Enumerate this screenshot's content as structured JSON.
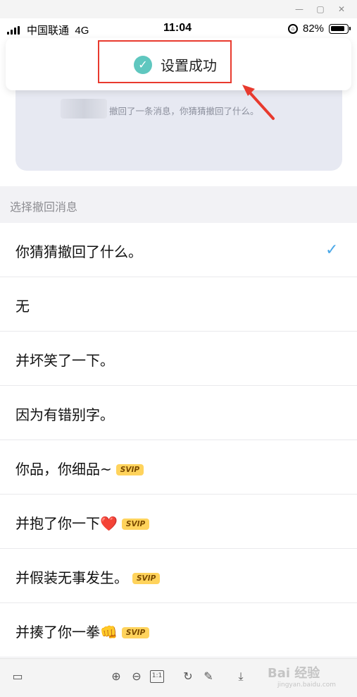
{
  "status_bar": {
    "carrier": "中国联通",
    "network": "4G",
    "time": "11:04",
    "battery": "82%",
    "battery_level": 0.82
  },
  "toast": {
    "message": "设置成功",
    "icon": "check-circle-icon",
    "icon_color": "#5fc7bf",
    "highlight_color": "#e83a2e"
  },
  "preview": {
    "text": "撤回了一条消息，你猜猜撤回了什么。"
  },
  "section": {
    "title": "选择撤回消息"
  },
  "options": [
    {
      "label": "你猜猜撤回了什么。",
      "selected": true,
      "svip": false
    },
    {
      "label": "无",
      "selected": false,
      "svip": false
    },
    {
      "label": "并坏笑了一下。",
      "selected": false,
      "svip": false
    },
    {
      "label": "因为有错别字。",
      "selected": false,
      "svip": false
    },
    {
      "label": "你品，你细品~",
      "selected": false,
      "svip": true
    },
    {
      "label": "并抱了你一下",
      "emoji": "❤️",
      "selected": false,
      "svip": true
    },
    {
      "label": "并假装无事发生。",
      "selected": false,
      "svip": true
    },
    {
      "label": "并揍了你一拳",
      "emoji": "👊",
      "selected": false,
      "svip": true
    }
  ],
  "svip_badge": "SVIP",
  "check_color": "#4aa8e8",
  "toolbar": {
    "zoom_ratio": "1:1"
  },
  "watermark": {
    "text": "Bai 经验",
    "sub": "jingyan.baidu.com"
  }
}
